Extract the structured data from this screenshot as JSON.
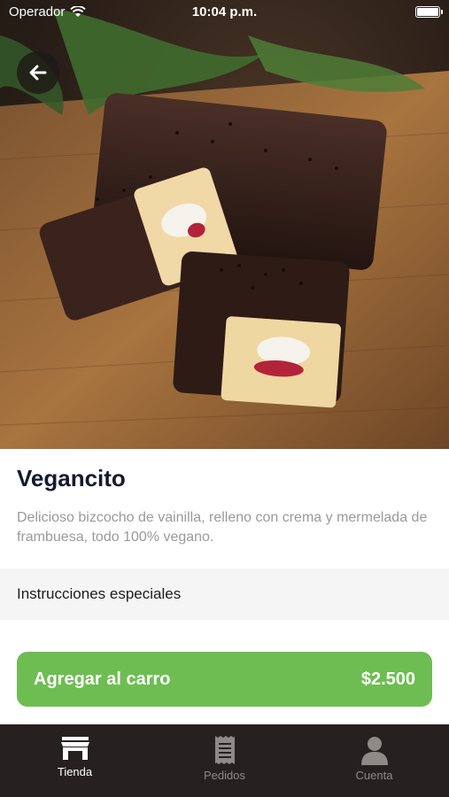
{
  "status_bar": {
    "carrier": "Operador",
    "time": "10:04 p.m."
  },
  "product": {
    "name": "Vegancito",
    "description": "Delicioso bizcocho de vainilla, relleno con crema y mermelada de frambuesa, todo 100% vegano.",
    "special_instructions_label": "Instrucciones especiales"
  },
  "cart_button": {
    "label": "Agregar al carro",
    "price": "$2.500"
  },
  "tab_bar": {
    "tabs": [
      {
        "label": "Tienda",
        "icon": "store-icon",
        "active": true
      },
      {
        "label": "Pedidos",
        "icon": "receipt-icon",
        "active": false
      },
      {
        "label": "Cuenta",
        "icon": "person-icon",
        "active": false
      }
    ]
  },
  "colors": {
    "accent_green": "#6ebd52",
    "tab_bar_bg": "#262021",
    "title_color": "#141a2e"
  }
}
